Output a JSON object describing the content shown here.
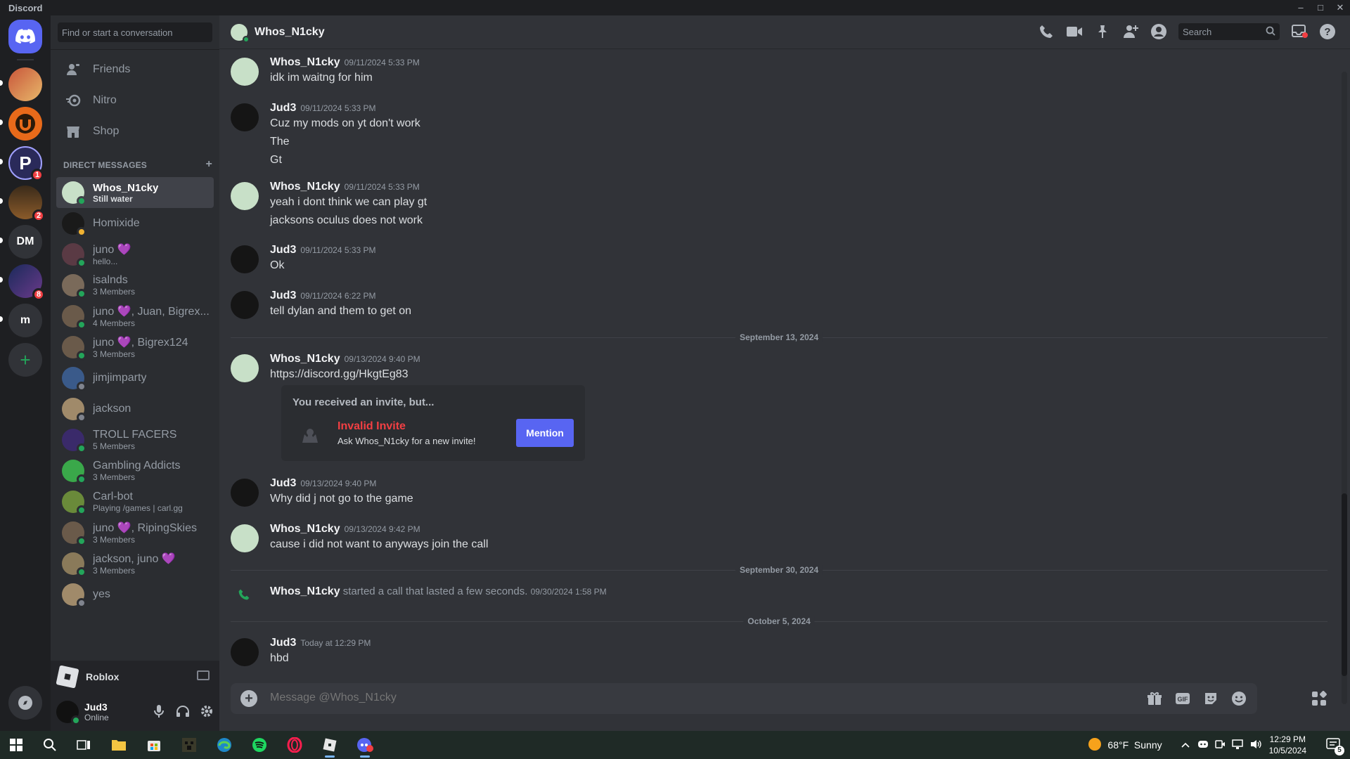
{
  "window": {
    "title": "Discord"
  },
  "servers": {
    "badges": [
      "1",
      "2",
      "8"
    ],
    "dm_label": "DM",
    "m_label": "m",
    "add_label": "+"
  },
  "sidebar": {
    "search_placeholder": "Find or start a conversation",
    "nav": {
      "friends": "Friends",
      "nitro": "Nitro",
      "shop": "Shop"
    },
    "dm_header": "DIRECT MESSAGES",
    "dm_add": "+",
    "dms": [
      {
        "name": "Whos_N1cky",
        "sub": "Still water",
        "status": "online",
        "color": "#c8e0c8"
      },
      {
        "name": "Homixide",
        "sub": "",
        "status": "idle",
        "color": "#1a1a1a"
      },
      {
        "name": "juno 💜",
        "sub": "hello...",
        "status": "online",
        "color": "#5a3a44"
      },
      {
        "name": "isalnds",
        "sub": "3 Members",
        "status": "online",
        "color": "#7a6a5a"
      },
      {
        "name": "juno 💜, Juan, Bigrex...",
        "sub": "4 Members",
        "status": "online",
        "color": "#6a5a4a"
      },
      {
        "name": "juno 💜, Bigrex124",
        "sub": "3 Members",
        "status": "online",
        "color": "#6a5a4a"
      },
      {
        "name": "jimjimparty",
        "sub": "",
        "status": "offline",
        "color": "#3a5a8a"
      },
      {
        "name": "jackson",
        "sub": "",
        "status": "offline",
        "color": "#a08a6a"
      },
      {
        "name": "TROLL FACERS",
        "sub": "5 Members",
        "status": "online",
        "color": "#3a2a6a"
      },
      {
        "name": "Gambling Addicts",
        "sub": "3 Members",
        "status": "online",
        "color": "#3aa84a"
      },
      {
        "name": "Carl-bot",
        "sub": "Playing /games | carl.gg",
        "status": "online",
        "color": "#6a8a3a"
      },
      {
        "name": "juno 💜, RipingSkies",
        "sub": "3 Members",
        "status": "online",
        "color": "#6a5a4a"
      },
      {
        "name": "jackson, juno 💜",
        "sub": "3 Members",
        "status": "online",
        "color": "#8a7a5a"
      },
      {
        "name": "yes",
        "sub": "",
        "status": "offline",
        "color": "#a08a6a"
      }
    ],
    "activity": "Roblox",
    "user": {
      "name": "Jud3",
      "status": "Online"
    }
  },
  "chat": {
    "header_title": "Whos_N1cky",
    "search_placeholder": "Search",
    "messages": [
      {
        "author": "Whos_N1cky",
        "time": "09/11/2024 5:33 PM",
        "lines": [
          "idk im waitng for him"
        ]
      },
      {
        "author": "Jud3",
        "time": "09/11/2024 5:33 PM",
        "lines": [
          "Cuz my mods on yt don't work",
          "The",
          "Gt"
        ]
      },
      {
        "author": "Whos_N1cky",
        "time": "09/11/2024 5:33 PM",
        "lines": [
          "yeah  i dont think we can play gt",
          "jacksons oculus does not work"
        ]
      },
      {
        "author": "Jud3",
        "time": "09/11/2024 5:33 PM",
        "lines": [
          "Ok"
        ]
      },
      {
        "author": "Jud3",
        "time": "09/11/2024 6:22 PM",
        "lines": [
          "tell dylan and them to get on"
        ]
      },
      {
        "author": "Whos_N1cky",
        "time": "09/13/2024 9:40 PM",
        "lines": [
          "https://discord.gg/HkgtEg83"
        ]
      },
      {
        "author": "Jud3",
        "time": "09/13/2024 9:40 PM",
        "lines": [
          "Why did j not go to the game"
        ]
      },
      {
        "author": "Whos_N1cky",
        "time": "09/13/2024 9:42 PM",
        "lines": [
          "cause i did not want to anyways join the call"
        ]
      },
      {
        "author": "Jud3",
        "time": "Today at 12:29 PM",
        "lines": [
          "hbd"
        ]
      }
    ],
    "dividers": [
      "September 13, 2024",
      "September 30, 2024",
      "October 5, 2024"
    ],
    "invite": {
      "heading": "You received an invite, but...",
      "title": "Invalid Invite",
      "subtitle": "Ask Whos_N1cky for a new invite!",
      "button": "Mention"
    },
    "call": {
      "author": "Whos_N1cky",
      "text": "started a call that lasted a few seconds.",
      "time": "09/30/2024 1:58 PM"
    },
    "composer_placeholder": "Message @Whos_N1cky",
    "gif_label": "GIF"
  },
  "taskbar": {
    "weather": "68°F  Sunny",
    "time": "12:29 PM",
    "date": "10/5/2024",
    "notif_count": "5"
  }
}
